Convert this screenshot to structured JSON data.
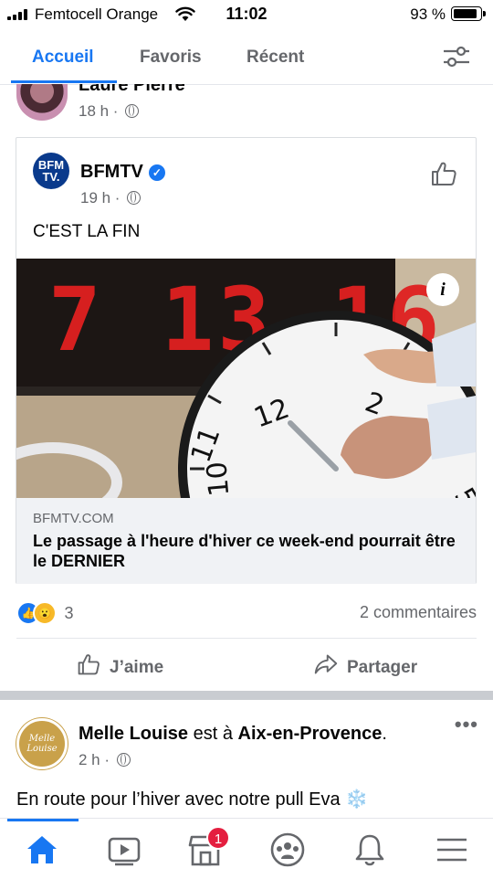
{
  "status_bar": {
    "carrier": "Femtocell Orange",
    "time": "11:02",
    "battery": "93 %",
    "battery_level": 0.93
  },
  "tabs": [
    {
      "label": "Accueil",
      "active": true
    },
    {
      "label": "Favoris",
      "active": false
    },
    {
      "label": "Récent",
      "active": false
    }
  ],
  "prev_post": {
    "author": "Laure Pierre",
    "time": "18 h ·"
  },
  "shared_post": {
    "page_name": "BFMTV",
    "logo_text": "BFM TV.",
    "time": "19 h ·",
    "text": "C'EST LA FIN",
    "image_digits": "7 13 16",
    "link_domain": "BFMTV.COM",
    "link_title": "Le passage à l'heure d'hiver ce week-end pourrait être le DERNIER"
  },
  "engagement": {
    "reaction_count": "3",
    "comments": "2 commentaires"
  },
  "actions": {
    "like": "J’aime",
    "share": "Partager"
  },
  "next_post": {
    "avatar_text": "Melle Louise",
    "author": "Melle Louise",
    "connector": " est à ",
    "place": "Aix-en-Provence",
    "place_suffix": ".",
    "time": "2 h ·",
    "text": "En route pour l’hiver avec notre pull Eva ❄️"
  },
  "bottom_nav": {
    "marketplace_badge": "1"
  },
  "colors": {
    "accent": "#1877f2",
    "badge": "#e41e3f",
    "secondary_text": "#65676b"
  }
}
